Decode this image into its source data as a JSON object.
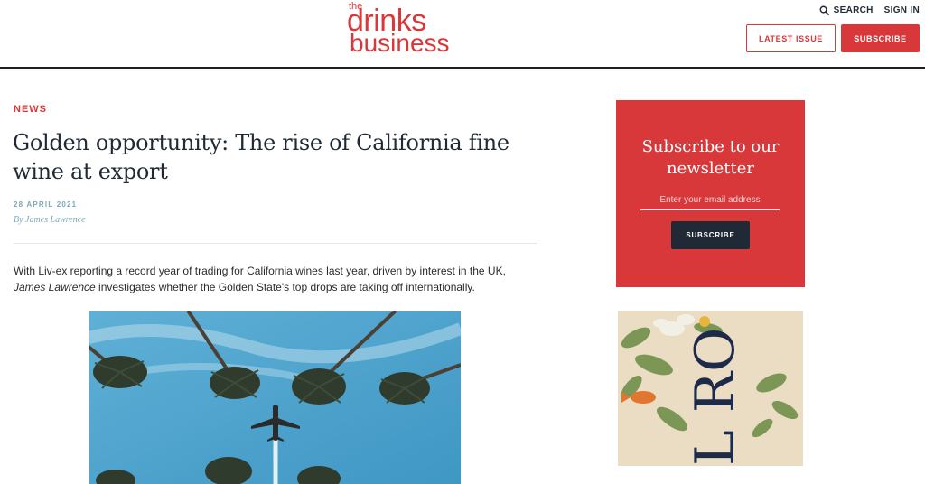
{
  "header": {
    "logo": {
      "the": "the",
      "drinks": "drinks",
      "business": "business"
    },
    "search_label": "SEARCH",
    "signin_label": "SIGN IN",
    "latest_issue_label": "LATEST ISSUE",
    "subscribe_label": "SUBSCRIBE"
  },
  "article": {
    "category": "NEWS",
    "title": "Golden opportunity: The rise of California fine wine at export",
    "date": "28 APRIL 2021",
    "byline": "By James Lawrence",
    "standfirst_part1": "With Liv-ex reporting a record year of trading for California wines last year, driven by interest in the UK, ",
    "standfirst_author": "James Lawrence",
    "standfirst_part2": " investigates whether the Golden State's top drops are taking off internationally."
  },
  "newsletter": {
    "title": "Subscribe to our newsletter",
    "email_placeholder": "Enter your email address",
    "button_label": "SUBSCRIBE"
  },
  "ad": {
    "text": "L RO"
  },
  "colors": {
    "brand_red": "#d9383a",
    "navy": "#1f2a36",
    "accent_teal": "#7aa9b6"
  }
}
